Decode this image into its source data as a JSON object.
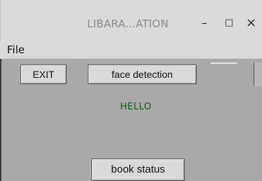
{
  "window": {
    "title": "LIBARA...ATION",
    "controls": {
      "minimize": "–",
      "maximize": "□",
      "close": "×"
    }
  },
  "menubar": {
    "items": [
      {
        "label": "File"
      }
    ]
  },
  "buttons": {
    "exit": "EXIT",
    "face_detection": "face detection",
    "book_status": "book status"
  },
  "status": {
    "text": "HELLO",
    "color": "#0b5e0b"
  },
  "colors": {
    "background": "#a9a9a9",
    "bar": "#d9d9d9"
  }
}
